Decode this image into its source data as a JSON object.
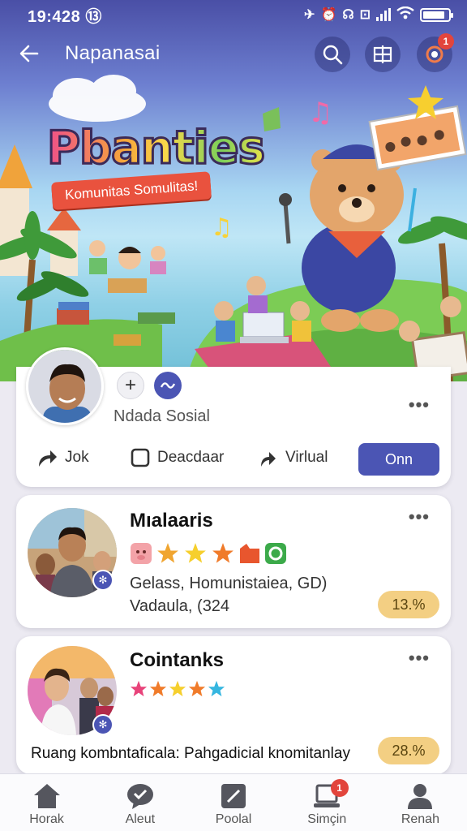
{
  "status_bar": {
    "time": "19:428 ⑬",
    "icons": [
      "airplane-icon",
      "alarm-icon",
      "headset-icon",
      "nfc-icon",
      "wifi-icon",
      "signal-icon",
      "battery-icon"
    ],
    "battery_level": 0.85
  },
  "app_bar": {
    "title": "Napanasai",
    "notification_count": "1"
  },
  "hero": {
    "title": "Pbanties",
    "banner": "Komunitas Somulitas!"
  },
  "profile": {
    "name": "Ndada Sosial",
    "more": "•••",
    "actions": [
      {
        "label": "Jok",
        "icon": "share-arrow-icon"
      },
      {
        "label": "Deacdaar",
        "icon": "checkbox-icon"
      },
      {
        "label": "Virlual",
        "icon": "forward-arrow-icon"
      }
    ],
    "primary_action": "Onn"
  },
  "feed": [
    {
      "title": "Mıalaaris",
      "line1": "Gelass, Homunistaiea, GD)",
      "line2": "Vadaula, (324",
      "percent": "13.%",
      "more": "•••"
    },
    {
      "title": "Cointanks",
      "line1": "Ruang kombntaficala: Pahgadicial knomitanlay",
      "percent": "28.%",
      "more": "•••"
    }
  ],
  "bottom_nav": [
    {
      "label": "Horak",
      "icon": "home-icon"
    },
    {
      "label": "Aleut",
      "icon": "chat-heart-icon"
    },
    {
      "label": "Poolal",
      "icon": "edit-icon"
    },
    {
      "label": "Simçin",
      "icon": "laptop-icon",
      "badge": "1"
    },
    {
      "label": "Renah",
      "icon": "person-icon"
    }
  ],
  "colors": {
    "primary": "#4b55b4",
    "badge": "#e2453c",
    "pill": "#f3cf83"
  }
}
